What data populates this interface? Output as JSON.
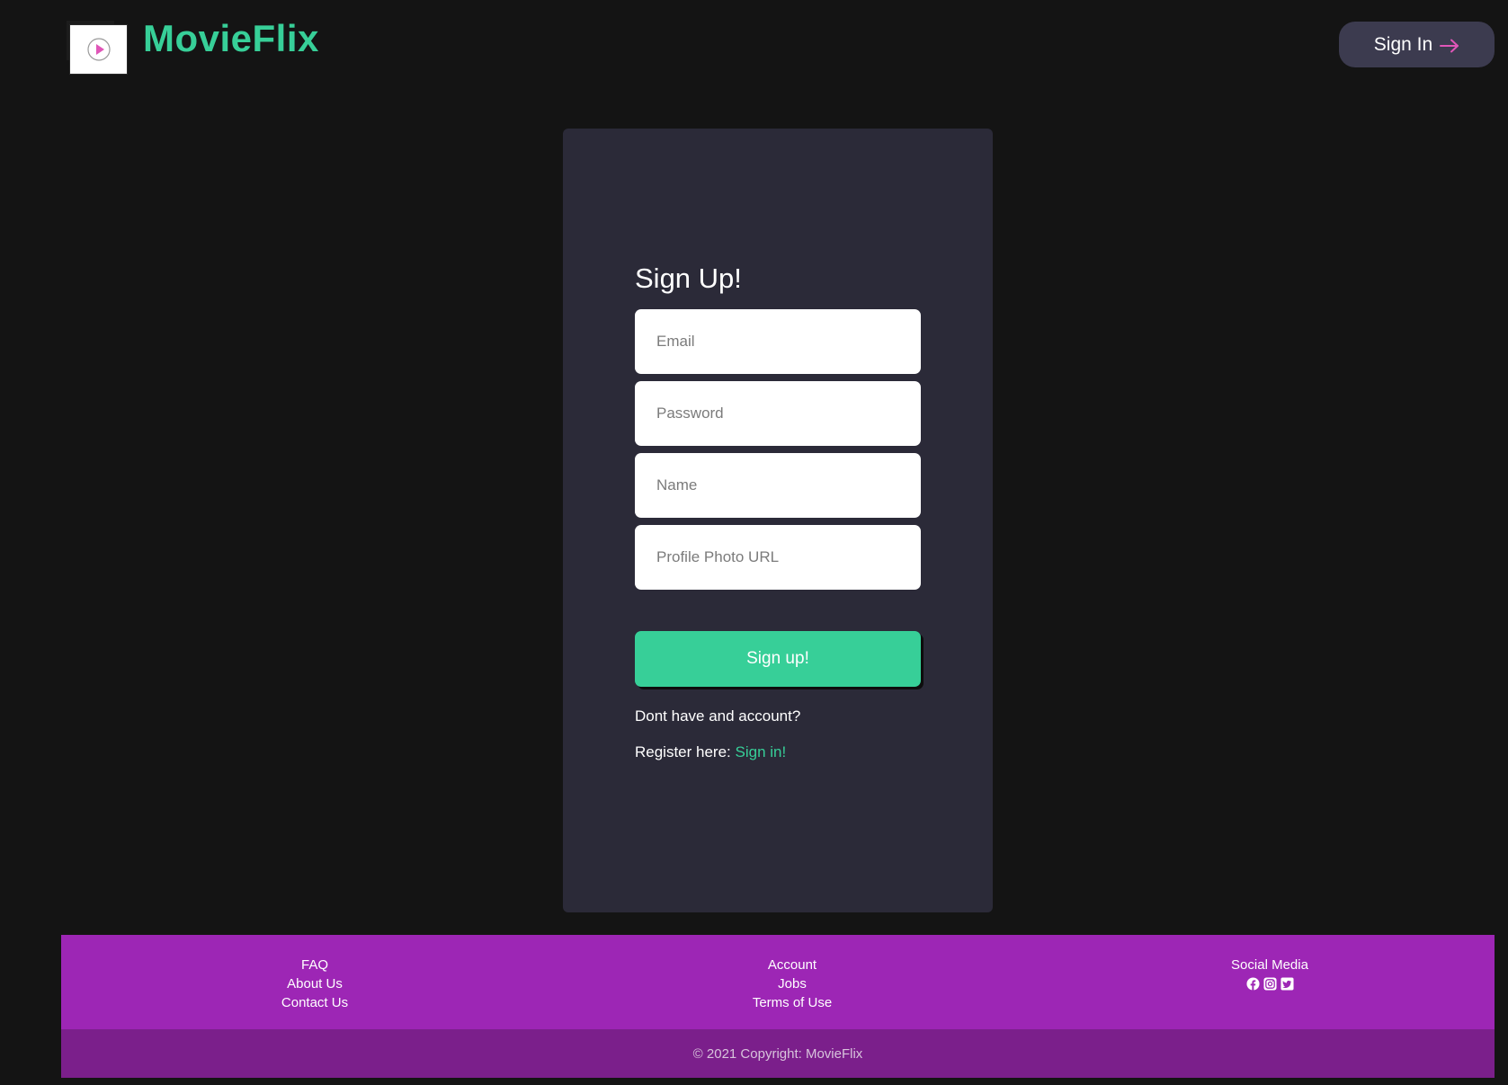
{
  "header": {
    "brand": "MovieFlix",
    "signin_label": "Sign In",
    "colors": {
      "brand": "#37cf98",
      "button_bg": "#3c3b4f",
      "arrow": "#e056b8"
    }
  },
  "form": {
    "title": "Sign Up!",
    "email_placeholder": "Email",
    "password_placeholder": "Password",
    "name_placeholder": "Name",
    "photo_placeholder": "Profile Photo URL",
    "submit_label": "Sign up!",
    "prompt_text": "Dont have and account?",
    "register_text": "Register here: ",
    "register_link": "Sign in!",
    "colors": {
      "card_bg": "#2b2a38",
      "accent": "#37cf98"
    }
  },
  "footer": {
    "col1": [
      "FAQ",
      "About Us",
      "Contact Us"
    ],
    "col2": [
      "Account",
      "Jobs",
      "Terms of Use"
    ],
    "social_heading": "Social Media",
    "social_icons": [
      "facebook-icon",
      "instagram-icon",
      "twitter-icon"
    ],
    "copyright": "© 2021 Copyright: MovieFlix",
    "colors": {
      "top_bg": "#9d26b5",
      "bottom_bg": "#7b1f8b"
    }
  }
}
